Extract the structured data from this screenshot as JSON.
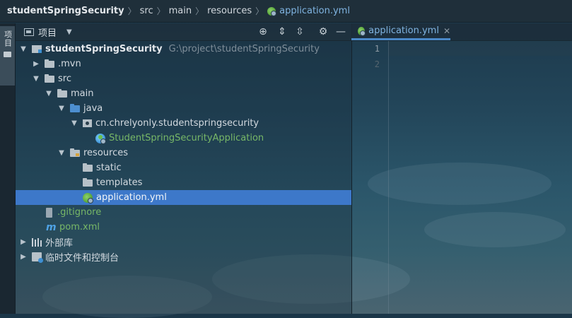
{
  "breadcrumb": [
    "studentSpringSecurity",
    "src",
    "main",
    "resources",
    "application.yml"
  ],
  "left_stripe": {
    "label": "项目"
  },
  "panel": {
    "title": "项目",
    "tools": [
      "locate-icon",
      "expand-all-icon",
      "collapse-all-icon",
      "gear-icon",
      "minimize-icon"
    ]
  },
  "tree": [
    {
      "label": "studentSpringSecurity",
      "path": "G:\\project\\studentSpringSecurity",
      "icon": "project-folder-icon",
      "expanded": true
    },
    {
      "label": ".mvn",
      "icon": "folder-icon",
      "expanded": false
    },
    {
      "label": "src",
      "icon": "folder-icon",
      "expanded": true
    },
    {
      "label": "main",
      "icon": "folder-icon",
      "expanded": true
    },
    {
      "label": "java",
      "icon": "source-folder-icon",
      "expanded": true
    },
    {
      "label": "cn.chrelyonly.studentspringsecurity",
      "icon": "package-icon",
      "expanded": true
    },
    {
      "label": "StudentSpringSecurityApplication",
      "icon": "spring-boot-app-icon"
    },
    {
      "label": "resources",
      "icon": "resources-folder-icon",
      "expanded": true
    },
    {
      "label": "static",
      "icon": "folder-icon"
    },
    {
      "label": "templates",
      "icon": "folder-icon"
    },
    {
      "label": "application.yml",
      "icon": "spring-config-icon",
      "selected": true
    },
    {
      "label": ".gitignore",
      "icon": "gitignore-icon"
    },
    {
      "label": "pom.xml",
      "icon": "maven-icon"
    },
    {
      "label": "外部库",
      "icon": "libraries-icon",
      "expanded": false
    },
    {
      "label": "临时文件和控制台",
      "icon": "scratches-icon",
      "expanded": false
    }
  ],
  "editor": {
    "tab_label": "application.yml",
    "line_numbers": [
      "1",
      "2"
    ]
  },
  "colors": {
    "selection": "#3d78c9",
    "green_file": "#77b767",
    "tab_accent": "#4a88c7",
    "breadcrumb_file": "#7fb3e0"
  }
}
